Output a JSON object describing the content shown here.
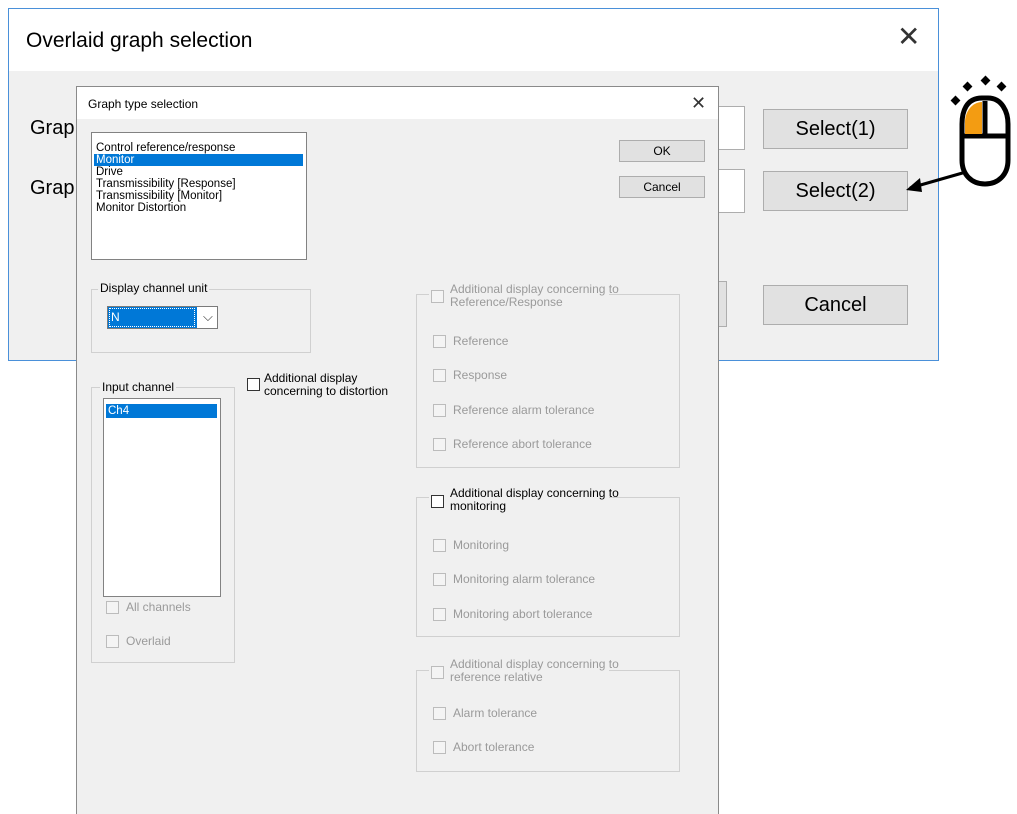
{
  "outer": {
    "title": "Overlaid graph selection",
    "close": "✕",
    "label1": "Grap",
    "label2": "Grap",
    "select1": "Select(1)",
    "select2": "Select(2)",
    "cancel": "Cancel"
  },
  "inner": {
    "title": "Graph type selection",
    "close": "✕",
    "graph_types": [
      "Control reference/response",
      "Monitor",
      "Drive",
      "Transmissibility [Response]",
      "Transmissibility [Monitor]",
      "Monitor Distortion"
    ],
    "selected_graph_type": "Monitor",
    "ok": "OK",
    "cancel": "Cancel",
    "display_unit": {
      "title": "Display channel unit",
      "value": "N",
      "dropdown_glyph": "⌵"
    },
    "input_channel": {
      "title": "Input channel",
      "items": [
        "Ch4"
      ],
      "all_channels": "All channels",
      "overlaid": "Overlaid"
    },
    "distortion": {
      "line1": "Additional display",
      "line2": "concerning to distortion"
    },
    "ref_response": {
      "title_line1": "Additional display concerning to",
      "title_line2": "Reference/Response",
      "items": [
        "Reference",
        "Response",
        "Reference alarm tolerance",
        "Reference abort tolerance"
      ]
    },
    "monitoring": {
      "title_line1": "Additional display concerning to",
      "title_line2": "monitoring",
      "items": [
        "Monitoring",
        "Monitoring alarm tolerance",
        "Monitoring abort tolerance"
      ]
    },
    "ref_relative": {
      "title_line1": "Additional display concerning to",
      "title_line2": "reference relative",
      "items": [
        "Alarm tolerance",
        "Abort tolerance"
      ]
    }
  },
  "colors": {
    "selection": "#0078d7",
    "mouse_accent": "#f39c12",
    "window_border": "#4a90d9"
  },
  "icons": {
    "mouse": "mouse-click-icon",
    "arrow": "pointer-arrow-icon"
  }
}
